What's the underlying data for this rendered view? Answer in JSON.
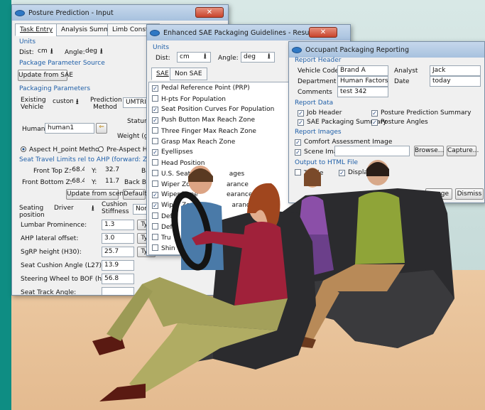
{
  "win1": {
    "title": "Posture Prediction - Input",
    "tabs": [
      "Task Entry",
      "Analysis Summary",
      "Limb Constra"
    ],
    "units_label": "Units",
    "dist_label": "Dist:",
    "dist_value": "cm",
    "angle_label": "Angle:",
    "angle_value": "deg",
    "pkg_source_label": "Package Parameter Source",
    "update_sae_btn": "Update from SAE",
    "pkg_params_label": "Packaging Parameters",
    "existing_vehicle_label": "Existing Vehicle",
    "existing_vehicle_value": "custom",
    "prediction_method_label": "Prediction Method",
    "prediction_method_value": "UMTRI A",
    "human_label": "Human",
    "human_value": "human1",
    "stature_label": "Stature:",
    "weight_label": "Weight (gra",
    "aspect_method": "Aspect H_point Method",
    "pre_aspect_method": "Pre-Aspect H_p",
    "seat_travel_label": "Seat Travel Limits rel to AHP  (forward: Z  (SAE -X",
    "front_top_label": "Front Top Z:",
    "front_top_z": "-68.4",
    "front_top_y_label": "Y:",
    "front_top_y": "32.7",
    "back_top_label": "Back",
    "front_bottom_label": "Front Bottom Z:",
    "front_bottom_z": "-68.4",
    "front_bottom_y_label": "Y:",
    "front_bottom_y": "11.7",
    "back_bottom_label": "Back Bot",
    "update_scene_btn": "Update from scene",
    "default_btn": "Default",
    "seating_position_label": "Seating position",
    "seating_position_value": "Driver",
    "cushion_stiffness_label": "Cushion Stiffness",
    "cushion_value": "Nor",
    "params": [
      {
        "label": "Lumbar Prominence:",
        "value": "1.3",
        "btn": "Typ"
      },
      {
        "label": "AHP lateral offset:",
        "value": "3.0",
        "btn": "Typ"
      },
      {
        "label": "SgRP height (H30):",
        "value": "25.7",
        "btn": "Typ"
      },
      {
        "label": "Seat Cushion Angle (L27):",
        "value": "13.9",
        "btn": ""
      },
      {
        "label": "Steering Wheel to BOF (hor.):",
        "value": "56.8",
        "btn": ""
      },
      {
        "label": "Seat Track Angle:",
        "value": "",
        "btn": ""
      }
    ]
  },
  "win2": {
    "title": "Enhanced SAE Packaging Guidelines - Results",
    "units_label": "Units",
    "dist_label": "Dist:",
    "dist_value": "cm",
    "angle_label": "Angle:",
    "angle_value": "deg",
    "tabs": [
      "SAE",
      "Non SAE"
    ],
    "items": [
      {
        "label": "Pedal Reference Point (PRP)",
        "checked": true
      },
      {
        "label": "H-pts For Population",
        "checked": false
      },
      {
        "label": "Seat Position Curves For Population",
        "checked": true
      },
      {
        "label": "Push Button Max Reach Zone",
        "checked": true
      },
      {
        "label": "Three Finger Max Reach Zone",
        "checked": false
      },
      {
        "label": "Grasp Max Reach Zone",
        "checked": false
      },
      {
        "label": "Eyellipses",
        "checked": true
      },
      {
        "label": "Head Position",
        "checked": false
      },
      {
        "label": "U.S. Seat Be",
        "checked": false
      },
      {
        "label": "Wiper Zone",
        "checked": false
      },
      {
        "label": "Wiper Zone",
        "checked": true
      },
      {
        "label": "Wiper Zones,",
        "checked": true
      },
      {
        "label": "Defr",
        "checked": false
      },
      {
        "label": "Def",
        "checked": false
      },
      {
        "label": "Tru",
        "checked": false
      },
      {
        "label": "Shin",
        "checked": false
      }
    ],
    "item_suffixes": [
      "",
      "",
      "",
      "",
      "",
      "",
      "",
      "",
      "ages",
      "arance",
      "earance",
      "arance"
    ]
  },
  "win3": {
    "title": "Occupant Packaging Reporting",
    "report_header_label": "Report Header",
    "vehicle_code_label": "Vehicle Code",
    "vehicle_code_value": "Brand A",
    "analyst_label": "Analyst",
    "analyst_value": "Jack",
    "department_label": "Department",
    "department_value": "Human Factors",
    "date_label": "Date",
    "date_value": "today",
    "comments_label": "Comments",
    "comments_value": "test 342",
    "report_data_label": "Report Data",
    "job_header": "Job Header",
    "posture_summary": "Posture Prediction Summary",
    "sae_summary": "SAE Packaging Summary",
    "posture_angles": "Posture Angles",
    "report_images_label": "Report Images",
    "comfort_image": "Comfort Assessment Image",
    "scene_image": "Scene Image",
    "browse_btn": "Browse...",
    "capture_btn": "Capture...",
    "output_label": "Output to HTML File",
    "to_file": "To File",
    "display": "Display",
    "image_btn": "ge",
    "dismiss_btn": "Dismiss"
  },
  "colors": {
    "section": "#1f5fa8",
    "accent_teal": "#0e8d83"
  }
}
